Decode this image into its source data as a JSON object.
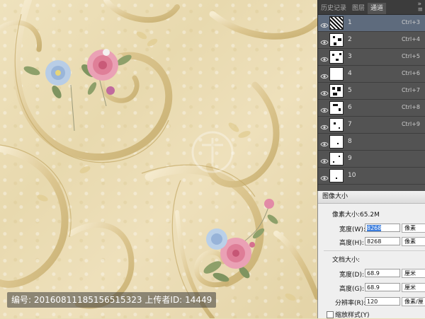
{
  "panel": {
    "tabs": [
      "历史记录",
      "图层",
      "通道"
    ],
    "active_tab": "通道",
    "channels": [
      {
        "name": "1",
        "shortcut": "Ctrl+3"
      },
      {
        "name": "2",
        "shortcut": "Ctrl+4"
      },
      {
        "name": "3",
        "shortcut": "Ctrl+5"
      },
      {
        "name": "4",
        "shortcut": "Ctrl+6"
      },
      {
        "name": "5",
        "shortcut": "Ctrl+7"
      },
      {
        "name": "6",
        "shortcut": "Ctrl+8"
      },
      {
        "name": "7",
        "shortcut": "Ctrl+9"
      },
      {
        "name": "8",
        "shortcut": ""
      },
      {
        "name": "9",
        "shortcut": ""
      },
      {
        "name": "10",
        "shortcut": ""
      }
    ]
  },
  "dialog": {
    "title": "图像大小",
    "pixel_size_label": "像素大小:65.2M",
    "width_label": "宽度(W):",
    "width_value": "8268",
    "width_unit": "像素",
    "height_label": "高度(H):",
    "height_value": "8268",
    "height_unit": "像素",
    "doc_size_label": "文档大小:",
    "doc_width_label": "宽度(D):",
    "doc_width_value": "68.9",
    "doc_width_unit": "厘米",
    "doc_height_label": "高度(G):",
    "doc_height_value": "68.9",
    "doc_height_unit": "厘米",
    "resolution_label": "分辨率(R):",
    "resolution_value": "120",
    "resolution_unit": "像素/厘",
    "scale_styles_label": "缩放样式(Y)"
  },
  "watermark": {
    "id_label": "编号:",
    "id_value": "20160811185156515323",
    "uploader_label": "上传者ID:",
    "uploader_value": "14449"
  },
  "colors": {
    "background": "#e9dcb6",
    "scroll_gold": "#d8c48c",
    "panel_bg": "#535353",
    "selected_row": "#5e6b7d",
    "rose_pink": "#e79bb1",
    "flower_blue": "#aac6e4"
  }
}
